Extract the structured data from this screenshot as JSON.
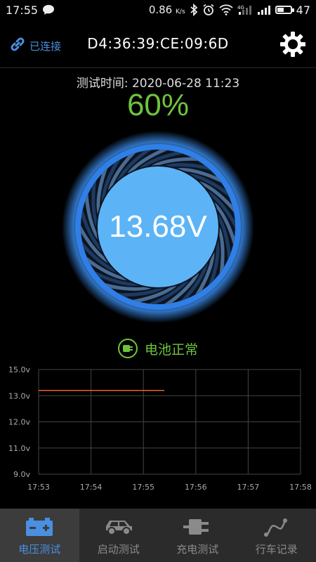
{
  "status_bar": {
    "time": "17:55",
    "speed": "0.86",
    "speed_unit": "K/s",
    "battery_level": "47",
    "network": "4G"
  },
  "header": {
    "connection_label": "已连接",
    "mac_address": "D4:36:39:CE:09:6D"
  },
  "test": {
    "time_label": "测试时间: 2020-06-28 11:23",
    "percent": "60%",
    "voltage": "13.68V",
    "status_label": "电池正常"
  },
  "colors": {
    "accent_blue": "#4a8fe0",
    "ok_green": "#6ec33e",
    "line_orange": "#e8622c"
  },
  "chart_data": {
    "type": "line",
    "y_ticks": [
      "15.0v",
      "13.0v",
      "12.0v",
      "11.0v",
      "9.0v"
    ],
    "x_ticks": [
      "17:53",
      "17:54",
      "17:55",
      "17:56",
      "17:57",
      "17:58"
    ],
    "series": [
      {
        "x": [
          "17:53",
          "17:54",
          "17:55",
          "17:55.4"
        ],
        "values": [
          13.4,
          13.4,
          13.4,
          13.4
        ]
      }
    ],
    "grid": true
  },
  "bottom_nav": [
    {
      "label": "电压测试",
      "icon": "battery-icon",
      "active": true
    },
    {
      "label": "启动测试",
      "icon": "car-icon",
      "active": false
    },
    {
      "label": "充电测试",
      "icon": "plug-icon",
      "active": false
    },
    {
      "label": "行车记录",
      "icon": "route-icon",
      "active": false
    }
  ]
}
